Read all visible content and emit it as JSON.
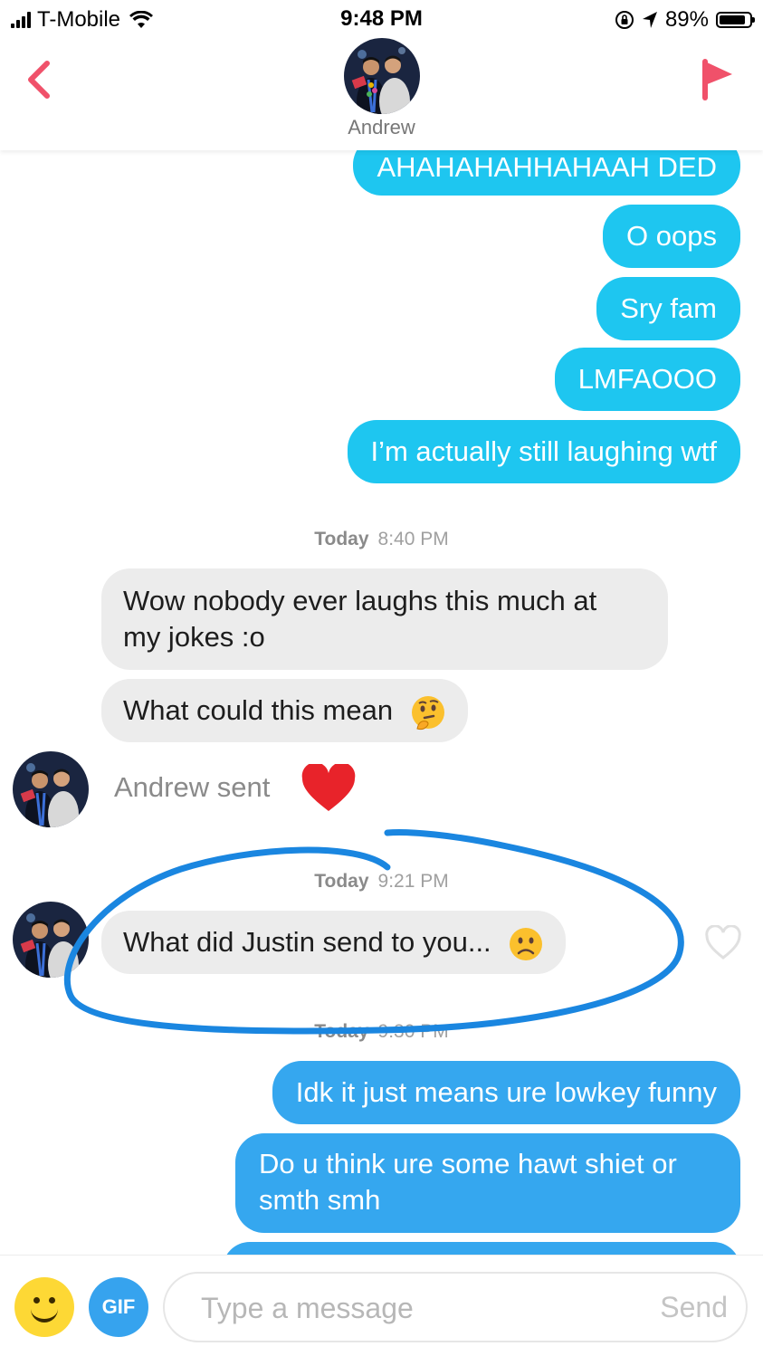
{
  "status_bar": {
    "carrier": "T-Mobile",
    "time": "9:48 PM",
    "battery": "89%",
    "battery_level": 0.89,
    "icons": [
      "signal-icon",
      "wifi-icon",
      "orientation-lock-icon",
      "location-arrow-icon",
      "battery-icon"
    ]
  },
  "header": {
    "contact_name": "Andrew",
    "back_icon": "chevron-left-icon",
    "report_icon": "flag-icon",
    "accent_color": "#f0516a"
  },
  "messages": [
    {
      "from": "me",
      "text": "AHAHAHAHHAHAAH DED"
    },
    {
      "from": "me",
      "text": "O oops"
    },
    {
      "from": "me",
      "text": "Sry fam"
    },
    {
      "from": "me",
      "text": "LMFAOOO"
    },
    {
      "from": "me",
      "text": "I’m actually still laughing wtf"
    },
    {
      "type": "timestamp",
      "day": "Today",
      "time": "8:40 PM"
    },
    {
      "from": "them",
      "lines": [
        "Wow nobody ever laughs this much at",
        "my jokes :o"
      ]
    },
    {
      "from": "them",
      "text": "What could this mean",
      "emoji": "thinking-face"
    },
    {
      "type": "like_notice",
      "text": "Andrew sent",
      "icon": "heart-icon"
    },
    {
      "type": "timestamp",
      "day": "Today",
      "time": "9:21 PM"
    },
    {
      "from": "them",
      "text": "What did Justin send to you...",
      "emoji": "slightly-frowning-face"
    },
    {
      "type": "timestamp",
      "day": "Today",
      "time": "9:30 PM"
    },
    {
      "from": "me",
      "text": "Idk it just means ure lowkey funny"
    },
    {
      "from": "me",
      "lines": [
        "Do u think ure some hawt shiet or",
        "smth smh"
      ]
    }
  ],
  "input_bar": {
    "placeholder": "Type a message",
    "send_label": "Send",
    "gif_label": "GIF"
  },
  "colors": {
    "outgoing_bubble": "#1ec6f0",
    "outgoing_bubble_recent": "#35a7ef",
    "incoming_bubble": "#ececec",
    "heart": "#e8232a",
    "annotation_circle": "#1a86e0"
  }
}
